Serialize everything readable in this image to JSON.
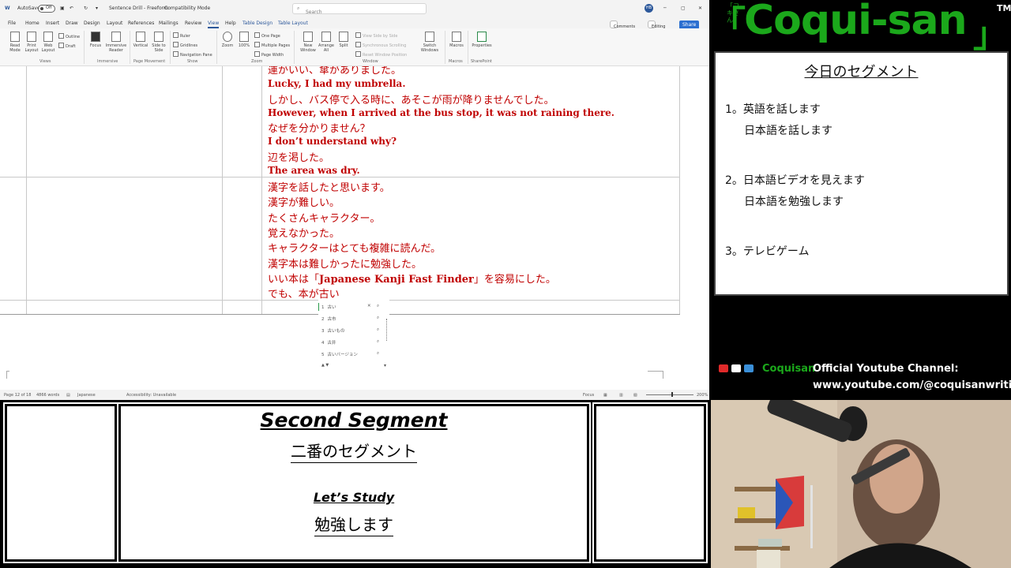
{
  "word": {
    "autosave": "AutoSave",
    "autosave_state": "Off",
    "doc_title": "Sentence Drill - Freeform",
    "mode": "Compatibility Mode",
    "search_placeholder": "Search",
    "user_initials": "HB",
    "menu": [
      "File",
      "Home",
      "Insert",
      "Draw",
      "Design",
      "Layout",
      "References",
      "Mailings",
      "Review",
      "View",
      "Help",
      "Table Design",
      "Table Layout"
    ],
    "active_menu": "View",
    "comments": "Comments",
    "editing": "Editing",
    "share": "Share",
    "ribbon": {
      "read_mode": "Read Mode",
      "print_layout": "Print Layout",
      "web_layout": "Web Layout",
      "outline": "Outline",
      "draft": "Draft",
      "focus": "Focus",
      "immersive_reader": "Immersive Reader",
      "vertical": "Vertical",
      "side_to_side": "Side to Side",
      "ruler": "Ruler",
      "gridlines": "Gridlines",
      "navigation_pane": "Navigation Pane",
      "zoom": "Zoom",
      "zoom_100": "100%",
      "one_page": "One Page",
      "multiple_pages": "Multiple Pages",
      "page_width": "Page Width",
      "new_window": "New Window",
      "arrange_all": "Arrange All",
      "split": "Split",
      "view_side_by_side": "View Side by Side",
      "sync_scrolling": "Synchronous Scrolling",
      "reset_window": "Reset Window Position",
      "switch_windows": "Switch Windows",
      "macros": "Macros",
      "properties": "Properties",
      "groups": [
        "Views",
        "Immersive",
        "Page Movement",
        "Show",
        "Zoom",
        "Window",
        "Macros",
        "SharePoint"
      ]
    },
    "lines": [
      {
        "text": "運がいい、傘がありました。",
        "en": false
      },
      {
        "text": "Lucky, I had my umbrella.",
        "en": true
      },
      {
        "text": "しかし、バス停で入る時に、あそこが雨が降りませんでした。",
        "en": false
      },
      {
        "text": "However, when I arrived at the bus stop, it was not raining there.",
        "en": true
      },
      {
        "text": "なぜを分かりません？",
        "en": false
      },
      {
        "text": "I don’t understand why?",
        "en": true
      },
      {
        "text": "辺を渇した。",
        "en": false
      },
      {
        "text": "The area was dry.",
        "en": true
      },
      {
        "text": "漢字を話したと思います。",
        "en": false
      },
      {
        "text": "漢字が難しい。",
        "en": false
      },
      {
        "text": "たくさんキャラクター。",
        "en": false
      },
      {
        "text": "覚えなかった。",
        "en": false
      },
      {
        "text": "キャラクターはとても複雑に読んだ。",
        "en": false
      },
      {
        "text": "漢字本は難しかったに勉強した。",
        "en": false
      }
    ],
    "line_book_pre": "いい本は「",
    "line_book_title": "Japanese Kanji Fast Finder",
    "line_book_post": "」を容易にした。",
    "line_last_pre": "でも、本が",
    "line_last_ime": "古い",
    "ime_candidates": [
      "古い",
      "古市",
      "古いもの",
      "古井",
      "古いバージョン"
    ],
    "status": {
      "page": "Page 12 of 18",
      "words": "4866 words",
      "language": "Japanese",
      "accessibility": "Accessibility: Unavailable",
      "focus": "Focus",
      "zoom": "200%"
    }
  },
  "logo": {
    "kana": "「コキさん」",
    "name": "Coqui-san",
    "tm": "TM"
  },
  "segments": {
    "title": "今日のセグメント",
    "items": [
      {
        "main": "1。英語を話します",
        "sub": "日本語を話します"
      },
      {
        "main": "2。日本語ビデオを見えます",
        "sub": "日本語を勉強します"
      },
      {
        "main": "3。テレビゲーム",
        "sub": ""
      }
    ]
  },
  "channel": {
    "name": "Coquisan",
    "label": "Official Youtube Channel:",
    "url": "www.youtube.com/@coquisanwriting"
  },
  "bottom": {
    "segment_en": "Second Segment",
    "segment_jp": "二番のセグメント",
    "study_en": "Let’s Study",
    "study_jp": "勉強します"
  },
  "colors": {
    "logo_green": "#1ba81b",
    "doc_red": "#c00000",
    "word_blue": "#2b579a"
  }
}
